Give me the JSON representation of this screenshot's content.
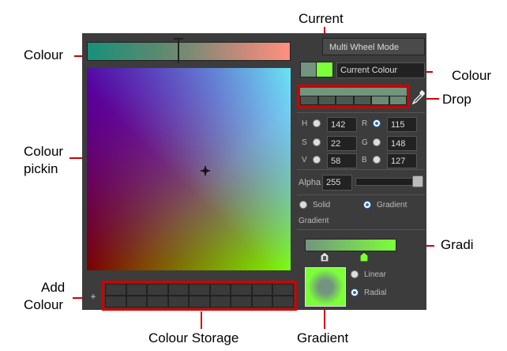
{
  "callouts": {
    "colour": "Colour",
    "current": "Current",
    "colour_drop_line1": "Colour",
    "colour_drop_line2": "Drop",
    "colour_picking_line1": "Colour",
    "colour_picking_line2": "pickin",
    "gradient_right": "Gradi",
    "add_colour_line1": "Add",
    "add_colour_line2": "Colour",
    "colour_storage": "Colour Storage",
    "gradient_bottom": "Gradient"
  },
  "panel": {
    "mode_button": "Multi Wheel Mode",
    "current_colour_label": "Current Colour",
    "current_swatch_color": "#73947f",
    "picked_swatch_color": "#7cff3a",
    "hsv": [
      {
        "label": "H",
        "value": "142"
      },
      {
        "label": "S",
        "value": "22"
      },
      {
        "label": "V",
        "value": "58"
      }
    ],
    "rgb": [
      {
        "label": "R",
        "value": "115"
      },
      {
        "label": "G",
        "value": "148"
      },
      {
        "label": "B",
        "value": "127"
      }
    ],
    "alpha_label": "Alpha",
    "alpha_value": "255",
    "alpha_level_fraction": 1.0,
    "solid_label": "Solid",
    "gradient_radio_label": "Gradient",
    "gradient_section_label": "Gradient",
    "linear_label": "Linear",
    "radial_label": "Radial",
    "add_button": "+",
    "selected_fill_type": "Gradient",
    "selected_gradient_type": "Radial"
  },
  "colors": {
    "highlight_red": "#d00000",
    "panel_bg": "#3c3c3c",
    "colour_bar_start": "#18907a",
    "colour_bar_end": "#ff9080",
    "gradient_start": "#73947f",
    "gradient_end": "#7cff3a"
  },
  "icons": {
    "eyedropper": "eyedropper-icon",
    "crosshair": "crosshair-icon",
    "lock": "lock-icon"
  }
}
